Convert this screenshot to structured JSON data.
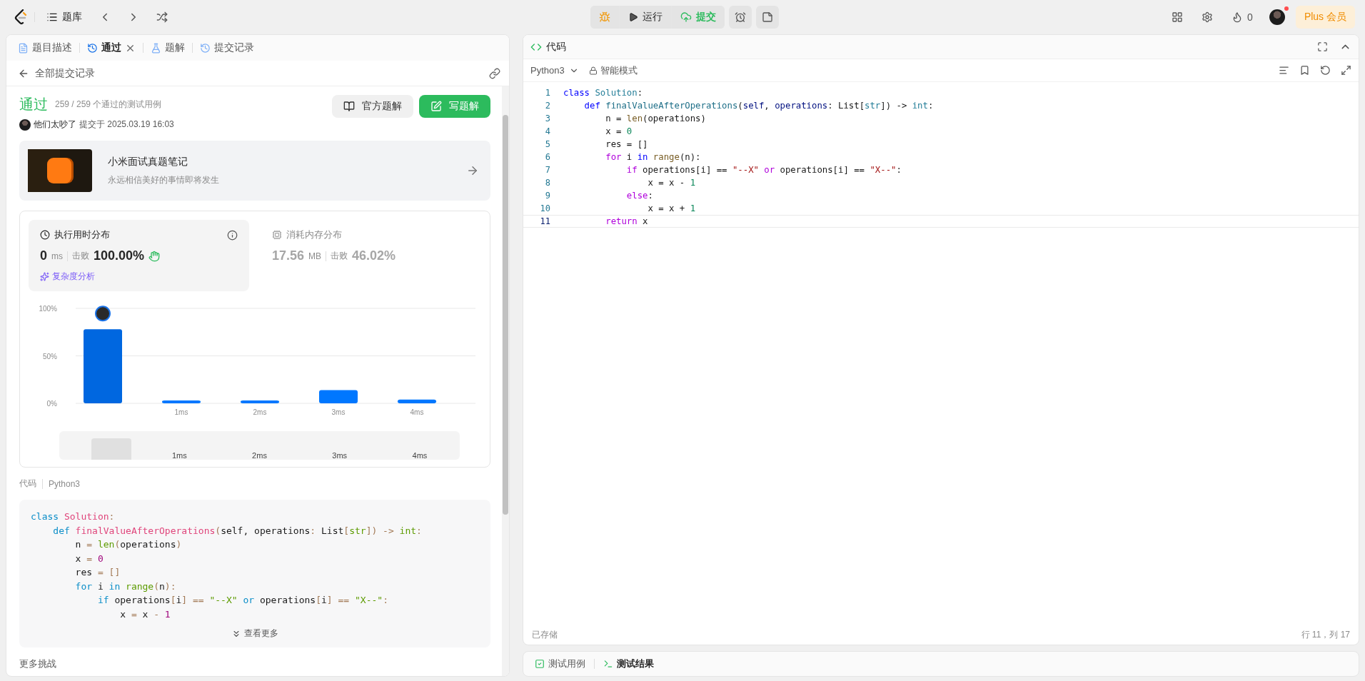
{
  "topbar": {
    "problem_list": "题库",
    "run": "运行",
    "submit": "提交",
    "points": "0",
    "plus": "Plus 会员"
  },
  "left_tabs": [
    {
      "label": "题目描述",
      "selected": false,
      "closable": false
    },
    {
      "label": "通过",
      "selected": true,
      "closable": true
    },
    {
      "label": "题解",
      "selected": false,
      "closable": false
    },
    {
      "label": "提交记录",
      "selected": false,
      "closable": false
    }
  ],
  "back": "全部提交记录",
  "result": {
    "status": "通过",
    "cases": "259 / 259 个通过的测试用例",
    "user": "他们太吵了",
    "submitted": "提交于 2025.03.19 16:03",
    "buttons": [
      "官方题解",
      "写题解"
    ]
  },
  "banner": {
    "title": "小米面试真题笔记",
    "subtitle": "永远相信美好的事情即将发生"
  },
  "stats": [
    {
      "title": "执行用时分布",
      "selected": true,
      "value": "0",
      "unit": "ms",
      "beat_label": "击败",
      "beat": "100.00%"
    },
    {
      "title": "消耗内存分布",
      "selected": false,
      "value": "17.56",
      "unit": "MB",
      "beat_label": "击败",
      "beat": "46.02%"
    }
  ],
  "analysis_link": "复杂度分析",
  "chart_data": {
    "type": "bar",
    "categories": [
      null,
      "1ms",
      "2ms",
      "3ms",
      "4ms"
    ],
    "values": [
      78,
      3,
      3,
      14,
      4
    ],
    "ylim": [
      0,
      100
    ],
    "yticks": [
      {
        "value": 0,
        "label": "0%"
      },
      {
        "value": 50,
        "label": "50%"
      },
      {
        "value": 100,
        "label": "100%"
      }
    ]
  },
  "brush_labels": [
    "1ms",
    "2ms",
    "3ms",
    "4ms"
  ],
  "code_section": {
    "label": "代码",
    "language": "Python3",
    "more": "查看更多",
    "lines": [
      [
        {
          "kind": "kw",
          "text": "class"
        },
        {
          "kind": "name",
          "text": " Solution"
        },
        {
          "kind": "punct",
          "text": ":"
        }
      ],
      [
        {
          "kind": "kw",
          "text": "    def"
        },
        {
          "kind": "name",
          "text": " finalValueAfterOperations"
        },
        {
          "kind": "punct",
          "text": "("
        },
        {
          "kind": "pl",
          "text": "self, operations"
        },
        {
          "kind": "punct",
          "text": ":"
        },
        {
          "kind": "pl",
          "text": " List"
        },
        {
          "kind": "punct",
          "text": "["
        },
        {
          "kind": "type",
          "text": "str"
        },
        {
          "kind": "punct",
          "text": "])"
        },
        {
          "kind": "punct",
          "text": " ->"
        },
        {
          "kind": "type",
          "text": " int"
        },
        {
          "kind": "punct",
          "text": ":"
        }
      ],
      [
        {
          "kind": "pl",
          "text": "        n"
        },
        {
          "kind": "punct",
          "text": " ="
        },
        {
          "kind": "builtin",
          "text": " len"
        },
        {
          "kind": "punct",
          "text": "("
        },
        {
          "kind": "pl",
          "text": "operations"
        },
        {
          "kind": "punct",
          "text": ")"
        }
      ],
      [
        {
          "kind": "pl",
          "text": "        x"
        },
        {
          "kind": "punct",
          "text": " ="
        },
        {
          "kind": "num",
          "text": " 0"
        }
      ],
      [
        {
          "kind": "pl",
          "text": "        res"
        },
        {
          "kind": "punct",
          "text": " ="
        },
        {
          "kind": "punct",
          "text": " []"
        }
      ],
      [
        {
          "kind": "ctl",
          "text": "        for"
        },
        {
          "kind": "pl",
          "text": " i"
        },
        {
          "kind": "kw",
          "text": " in"
        },
        {
          "kind": "builtin",
          "text": " range"
        },
        {
          "kind": "punct",
          "text": "("
        },
        {
          "kind": "pl",
          "text": "n"
        },
        {
          "kind": "punct",
          "text": "):"
        }
      ],
      [
        {
          "kind": "ctl",
          "text": "            if"
        },
        {
          "kind": "pl",
          "text": " operations"
        },
        {
          "kind": "punct",
          "text": "["
        },
        {
          "kind": "pl",
          "text": "i"
        },
        {
          "kind": "punct",
          "text": "]"
        },
        {
          "kind": "punct",
          "text": " =="
        },
        {
          "kind": "str",
          "text": " \"--X\""
        },
        {
          "kind": "ctl",
          "text": " or"
        },
        {
          "kind": "pl",
          "text": " operations"
        },
        {
          "kind": "punct",
          "text": "["
        },
        {
          "kind": "pl",
          "text": "i"
        },
        {
          "kind": "punct",
          "text": "]"
        },
        {
          "kind": "punct",
          "text": " =="
        },
        {
          "kind": "str",
          "text": " \"X--\""
        },
        {
          "kind": "punct",
          "text": ":"
        }
      ],
      [
        {
          "kind": "pl",
          "text": "                x"
        },
        {
          "kind": "punct",
          "text": " ="
        },
        {
          "kind": "pl",
          "text": " x"
        },
        {
          "kind": "punct",
          "text": " -"
        },
        {
          "kind": "num",
          "text": " 1"
        }
      ]
    ]
  },
  "more_challenges": "更多挑战",
  "editor": {
    "title": "代码",
    "language": "Python3",
    "mode": "智能模式",
    "saved": "已存储",
    "cursor": "行 11，列 17",
    "lines": [
      {
        "number": "1",
        "current": false,
        "tokens": [
          {
            "kind": "kw",
            "text": "class"
          },
          {
            "kind": "name",
            "text": " Solution"
          },
          {
            "kind": "punct",
            "text": ":"
          }
        ]
      },
      {
        "number": "2",
        "current": false,
        "tokens": [
          {
            "kind": "kw",
            "text": "    def"
          },
          {
            "kind": "fname",
            "text": " finalValueAfterOperations"
          },
          {
            "kind": "punct",
            "text": "("
          },
          {
            "kind": "param",
            "text": "self"
          },
          {
            "kind": "punct",
            "text": ", "
          },
          {
            "kind": "param",
            "text": "operations"
          },
          {
            "kind": "punct",
            "text": ": List["
          },
          {
            "kind": "type",
            "text": "str"
          },
          {
            "kind": "punct",
            "text": "]) ->"
          },
          {
            "kind": "type",
            "text": " int"
          },
          {
            "kind": "punct",
            "text": ":"
          }
        ]
      },
      {
        "number": "3",
        "current": false,
        "tokens": [
          {
            "kind": "pl",
            "text": "        n ="
          },
          {
            "kind": "builtin",
            "text": " len"
          },
          {
            "kind": "punct",
            "text": "(operations)"
          }
        ]
      },
      {
        "number": "4",
        "current": false,
        "tokens": [
          {
            "kind": "pl",
            "text": "        x ="
          },
          {
            "kind": "num",
            "text": " 0"
          }
        ]
      },
      {
        "number": "5",
        "current": false,
        "tokens": [
          {
            "kind": "pl",
            "text": "        res = []"
          }
        ]
      },
      {
        "number": "6",
        "current": false,
        "tokens": [
          {
            "kind": "ctl",
            "text": "        for"
          },
          {
            "kind": "pl",
            "text": " i"
          },
          {
            "kind": "kw",
            "text": " in"
          },
          {
            "kind": "builtin",
            "text": " range"
          },
          {
            "kind": "punct",
            "text": "(n):"
          }
        ]
      },
      {
        "number": "7",
        "current": false,
        "tokens": [
          {
            "kind": "ctl",
            "text": "            if"
          },
          {
            "kind": "pl",
            "text": " operations[i] =="
          },
          {
            "kind": "str",
            "text": " \"--X\""
          },
          {
            "kind": "ctl",
            "text": " or"
          },
          {
            "kind": "pl",
            "text": " operations[i] =="
          },
          {
            "kind": "str",
            "text": " \"X--\""
          },
          {
            "kind": "punct",
            "text": ":"
          }
        ]
      },
      {
        "number": "8",
        "current": false,
        "tokens": [
          {
            "kind": "pl",
            "text": "                x = x -"
          },
          {
            "kind": "num",
            "text": " 1"
          }
        ]
      },
      {
        "number": "9",
        "current": false,
        "tokens": [
          {
            "kind": "ctl",
            "text": "            else"
          },
          {
            "kind": "punct",
            "text": ":"
          }
        ]
      },
      {
        "number": "10",
        "current": false,
        "tokens": [
          {
            "kind": "pl",
            "text": "                x = x +"
          },
          {
            "kind": "num",
            "text": " 1"
          }
        ]
      },
      {
        "number": "11",
        "current": true,
        "tokens": [
          {
            "kind": "ctl",
            "text": "        return"
          },
          {
            "kind": "pl",
            "text": " x"
          }
        ]
      }
    ]
  },
  "bottom_tabs": [
    {
      "label": "测试用例",
      "selected": false
    },
    {
      "label": "测试结果",
      "selected": true
    }
  ]
}
